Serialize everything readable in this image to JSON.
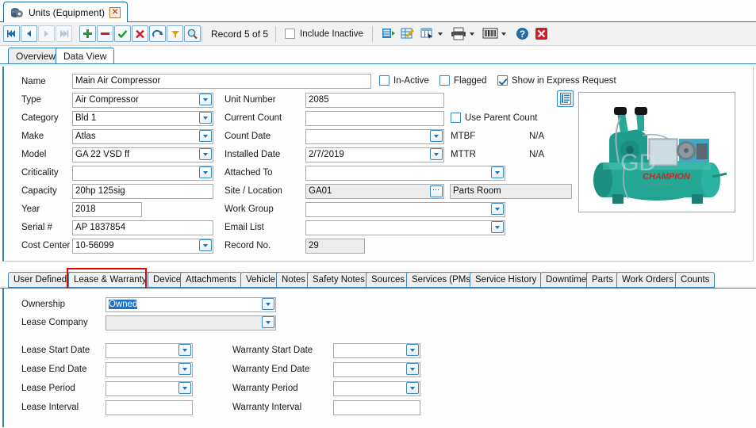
{
  "window": {
    "tab_title": "Units (Equipment)",
    "tab_icon": "equipment-gear-icon",
    "close_label": "✕"
  },
  "toolbar": {
    "nav": [
      {
        "name": "first-record",
        "glyph": "◀◀|",
        "enabled": true
      },
      {
        "name": "previous-record",
        "glyph": "◀",
        "enabled": true
      },
      {
        "name": "next-record",
        "glyph": "▶",
        "enabled": false
      },
      {
        "name": "last-record",
        "glyph": "|▶▶",
        "enabled": false
      }
    ],
    "actions": [
      {
        "name": "add-record",
        "glyph": "+",
        "color": "#1a9b2e"
      },
      {
        "name": "delete-record",
        "glyph": "−",
        "color": "#c8202a"
      },
      {
        "name": "post-record",
        "glyph": "✔",
        "color": "#1a9b2e"
      },
      {
        "name": "cancel-record",
        "glyph": "✖",
        "color": "#c8202a"
      },
      {
        "name": "refresh-record",
        "glyph": "↷",
        "color": "#1f6ca8"
      },
      {
        "name": "filter-records",
        "glyph": "▼",
        "color": "#e0a20b"
      },
      {
        "name": "search-records",
        "glyph": "⌕",
        "color": "#1f6ca8"
      }
    ],
    "record_status": "Record 5 of 5",
    "include_inactive_label": "Include Inactive",
    "include_inactive_checked": false,
    "right_icons": [
      {
        "name": "export-data-icon",
        "split": false
      },
      {
        "name": "edit-grid-icon",
        "split": false
      },
      {
        "name": "select-columns-icon",
        "split": true
      },
      {
        "name": "print-icon",
        "split": true
      },
      {
        "name": "barcode-icon",
        "split": true
      },
      {
        "name": "help-icon",
        "split": false
      },
      {
        "name": "close-window-icon",
        "split": false
      }
    ]
  },
  "page_tabs": [
    {
      "label": "Overview",
      "active": false
    },
    {
      "label": "Data View",
      "active": true
    }
  ],
  "form": {
    "left": [
      {
        "label": "Name",
        "value": "Main Air Compressor",
        "type": "text",
        "readonly": false
      },
      {
        "label": "Type",
        "value": "Air Compressor",
        "type": "combo",
        "readonly": false
      },
      {
        "label": "Category",
        "value": "Bld 1",
        "type": "combo",
        "readonly": false
      },
      {
        "label": "Make",
        "value": "Atlas",
        "type": "combo",
        "readonly": false
      },
      {
        "label": "Model",
        "value": "GA 22 VSD ff",
        "type": "combo",
        "readonly": false
      },
      {
        "label": "Criticality",
        "value": "",
        "type": "combo",
        "readonly": false
      },
      {
        "label": "Capacity",
        "value": "20hp 125sig",
        "type": "text",
        "readonly": false
      },
      {
        "label": "Year",
        "value": "2018",
        "type": "text",
        "readonly": false
      },
      {
        "label": "Serial #",
        "value": "AP 1837854",
        "type": "text",
        "readonly": false
      },
      {
        "label": "Cost Center",
        "value": "10-56099",
        "type": "combo",
        "readonly": false
      }
    ],
    "right": [
      {
        "label": "Unit Number",
        "value": "2085",
        "type": "text",
        "readonly": false
      },
      {
        "label": "Current Count",
        "value": "",
        "type": "text",
        "readonly": false
      },
      {
        "label": "Count Date",
        "value": "",
        "type": "combo",
        "readonly": false
      },
      {
        "label": "Installed Date",
        "value": "2/7/2019",
        "type": "combo",
        "readonly": false
      },
      {
        "label": "Attached To",
        "value": "",
        "type": "combo",
        "readonly": false
      },
      {
        "label": "Site / Location",
        "value": "GA01",
        "type": "lookup",
        "readonly": true
      },
      {
        "label": "Work Group",
        "value": "",
        "type": "combo",
        "readonly": false
      },
      {
        "label": "Email List",
        "value": "",
        "type": "combo",
        "readonly": false
      },
      {
        "label": "Record No.",
        "value": "29",
        "type": "text",
        "readonly": true
      }
    ],
    "location_name": "Parts Room",
    "checkboxes": [
      {
        "label": "In-Active",
        "checked": false
      },
      {
        "label": "Flagged",
        "checked": false
      },
      {
        "label": "Show in Express Request",
        "checked": true
      }
    ],
    "use_parent_count": {
      "label": "Use Parent Count",
      "checked": false
    },
    "metrics": [
      {
        "label": "MTBF",
        "value": "N/A"
      },
      {
        "label": "MTTR",
        "value": "N/A"
      }
    ],
    "image_alt": "champion-air-compressor-photo",
    "image_brand": "CHAMPION"
  },
  "bottom_tabs": [
    {
      "label": "User Defined",
      "active": false,
      "highlight": false
    },
    {
      "label": "Lease & Warranty",
      "active": true,
      "highlight": true
    },
    {
      "label": "Device",
      "active": false,
      "highlight": false
    },
    {
      "label": "Attachments",
      "active": false,
      "highlight": false
    },
    {
      "label": "Vehicle",
      "active": false,
      "highlight": false
    },
    {
      "label": "Notes",
      "active": false,
      "highlight": false
    },
    {
      "label": "Safety Notes",
      "active": false,
      "highlight": false
    },
    {
      "label": "Sources",
      "active": false,
      "highlight": false
    },
    {
      "label": "Services (PMs)",
      "active": false,
      "highlight": false
    },
    {
      "label": "Service History",
      "active": false,
      "highlight": false
    },
    {
      "label": "Downtime",
      "active": false,
      "highlight": false
    },
    {
      "label": "Parts",
      "active": false,
      "highlight": false
    },
    {
      "label": "Work Orders",
      "active": false,
      "highlight": false
    },
    {
      "label": "Counts",
      "active": false,
      "highlight": false
    }
  ],
  "lease": {
    "ownership": {
      "label": "Ownership",
      "value": "Owned",
      "selected": true
    },
    "lease_company": {
      "label": "Lease Company",
      "value": ""
    },
    "left_fields": [
      {
        "label": "Lease Start Date",
        "value": "",
        "type": "combo"
      },
      {
        "label": "Lease End Date",
        "value": "",
        "type": "combo"
      },
      {
        "label": "Lease Period",
        "value": "",
        "type": "combo"
      },
      {
        "label": "Lease Interval",
        "value": "",
        "type": "text"
      }
    ],
    "right_fields": [
      {
        "label": "Warranty Start Date",
        "value": "",
        "type": "combo"
      },
      {
        "label": "Warranty End Date",
        "value": "",
        "type": "combo"
      },
      {
        "label": "Warranty Period",
        "value": "",
        "type": "combo"
      },
      {
        "label": "Warranty Interval",
        "value": "",
        "type": "text"
      }
    ]
  },
  "colors": {
    "accent_blue": "#2f7fbb",
    "highlight_red": "#ef0000",
    "selection_blue": "#1f72c4",
    "panel_bg": "#fdfdfd",
    "readonly_bg": "#ececec"
  }
}
